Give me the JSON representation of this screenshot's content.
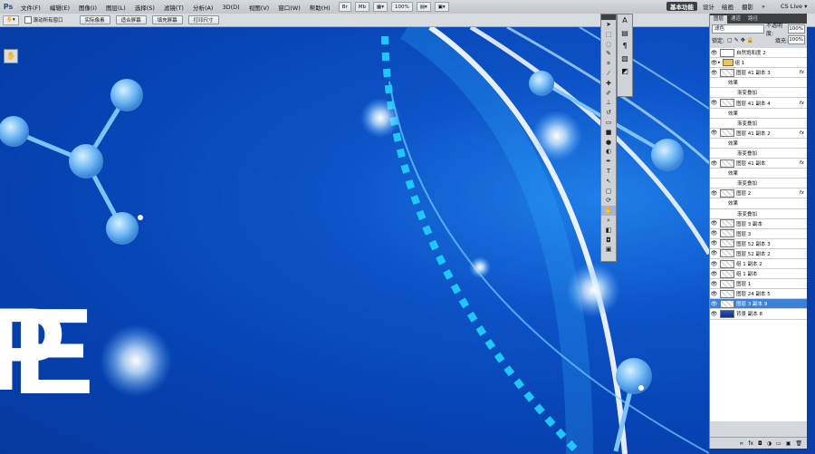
{
  "app": {
    "logo": "Ps"
  },
  "menu": [
    "文件(F)",
    "编辑(E)",
    "图像(I)",
    "图层(L)",
    "选择(S)",
    "滤镜(T)",
    "分析(A)",
    "3D(D)",
    "视图(V)",
    "窗口(W)",
    "帮助(H)"
  ],
  "menu_controls": {
    "zoom": "100%"
  },
  "workspace": {
    "active": "基本功能",
    "items": [
      "设计",
      "绘画",
      "摄影"
    ],
    "more": "»",
    "cslive": "CS Live ▾"
  },
  "options": {
    "checkbox_label": "滚动所有窗口",
    "buttons": [
      "实际像素",
      "适合屏幕",
      "填充屏幕",
      "打印尺寸"
    ]
  },
  "layers_panel": {
    "tabs": [
      "图层",
      "通道",
      "路径"
    ],
    "blend_mode": "滤色",
    "opacity_label": "不透明度:",
    "opacity_value": "100%",
    "lock_label": "锁定:",
    "fill_label": "填充:",
    "fill_value": "100%",
    "rows": [
      {
        "name": "自然饱和度 2",
        "kind": "adj"
      },
      {
        "name": "组 1",
        "kind": "folder"
      },
      {
        "name": "图层 41 副本 3",
        "kind": "layer",
        "fx": "fx"
      },
      {
        "name": "效果",
        "kind": "sub"
      },
      {
        "name": "渐变叠加",
        "kind": "sub2"
      },
      {
        "name": "图层 41 副本 4",
        "kind": "layer",
        "fx": "fx"
      },
      {
        "name": "效果",
        "kind": "sub"
      },
      {
        "name": "渐变叠加",
        "kind": "sub2"
      },
      {
        "name": "图层 41 副本 2",
        "kind": "layer",
        "fx": "fx"
      },
      {
        "name": "效果",
        "kind": "sub"
      },
      {
        "name": "渐变叠加",
        "kind": "sub2"
      },
      {
        "name": "图层 41 副本",
        "kind": "layer",
        "fx": "fx"
      },
      {
        "name": "效果",
        "kind": "sub"
      },
      {
        "name": "渐变叠加",
        "kind": "sub2"
      },
      {
        "name": "图层 2",
        "kind": "layer",
        "fx": "fx"
      },
      {
        "name": "效果",
        "kind": "sub"
      },
      {
        "name": "渐变叠加",
        "kind": "sub2"
      },
      {
        "name": "图层 3 副本",
        "kind": "layer"
      },
      {
        "name": "图层 3",
        "kind": "layer"
      },
      {
        "name": "图层 52 副本 3",
        "kind": "layer"
      },
      {
        "name": "图层 52 副本 2",
        "kind": "layer"
      },
      {
        "name": "组 1 副本 2",
        "kind": "layer"
      },
      {
        "name": "组 1 副本",
        "kind": "layer"
      },
      {
        "name": "图层 1",
        "kind": "layer"
      },
      {
        "name": "图层 24 副本 5",
        "kind": "layer"
      },
      {
        "name": "图层 3 副本 9",
        "kind": "layer",
        "selected": true
      },
      {
        "name": "背景 副本 8",
        "kind": "bg"
      }
    ]
  },
  "canvas_text": {
    "big_e": "E",
    "partial_letter": "P"
  }
}
